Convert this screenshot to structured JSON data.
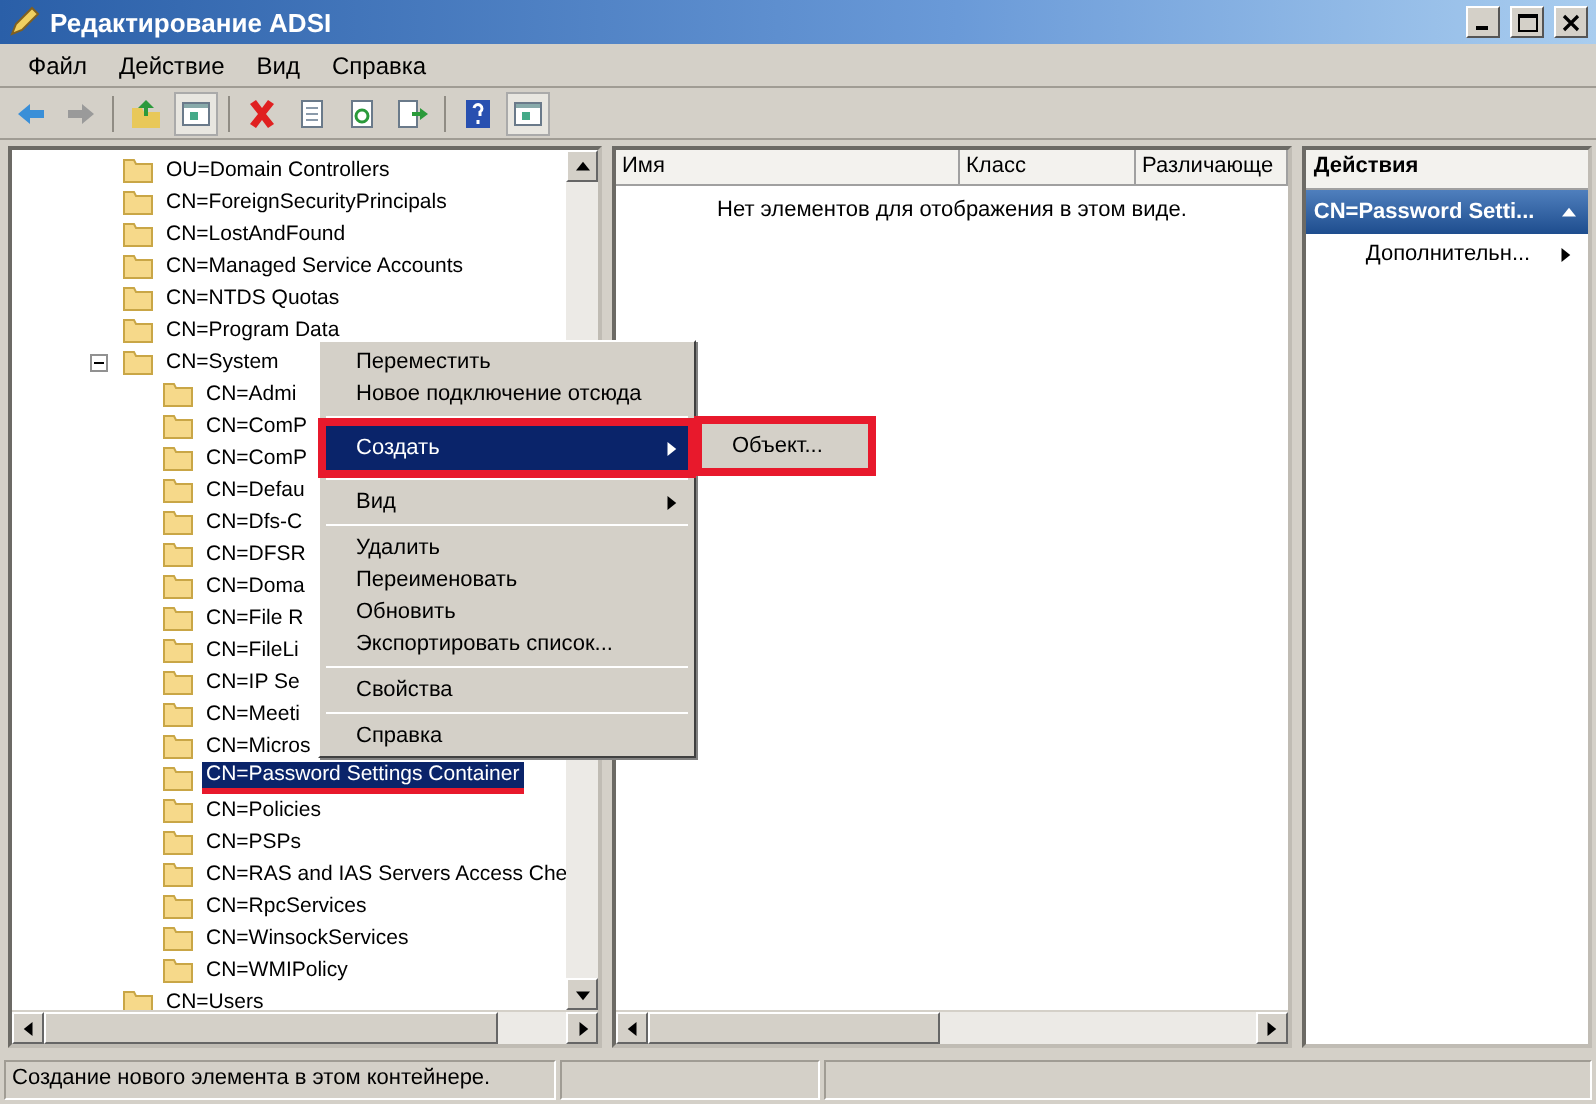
{
  "window": {
    "title": "Редактирование ADSI"
  },
  "menu_bar": [
    "Файл",
    "Действие",
    "Вид",
    "Справка"
  ],
  "tree": [
    {
      "label": "OU=Domain Controllers",
      "selected": false
    },
    {
      "label": "CN=ForeignSecurityPrincipals",
      "selected": false
    },
    {
      "label": "CN=LostAndFound",
      "selected": false
    },
    {
      "label": "CN=Managed Service Accounts",
      "selected": false
    },
    {
      "label": "CN=NTDS Quotas",
      "selected": false
    },
    {
      "label": "CN=Program Data",
      "selected": false
    },
    {
      "label": "CN=System",
      "selected": false,
      "expanded": true,
      "children": [
        {
          "label": "CN=Admi",
          "selected": false
        },
        {
          "label": "CN=ComP",
          "selected": false
        },
        {
          "label": "CN=ComP",
          "selected": false
        },
        {
          "label": "CN=Defau",
          "selected": false
        },
        {
          "label": "CN=Dfs-C",
          "selected": false
        },
        {
          "label": "CN=DFSR",
          "selected": false
        },
        {
          "label": "CN=Doma",
          "selected": false
        },
        {
          "label": "CN=File R",
          "selected": false
        },
        {
          "label": "CN=FileLi",
          "selected": false
        },
        {
          "label": "CN=IP Se",
          "selected": false
        },
        {
          "label": "CN=Meeti",
          "selected": false
        },
        {
          "label": "CN=Micros",
          "selected": false
        },
        {
          "label": "CN=Password Settings Container",
          "selected": true,
          "annotated": true
        },
        {
          "label": "CN=Policies",
          "selected": false
        },
        {
          "label": "CN=PSPs",
          "selected": false
        },
        {
          "label": "CN=RAS and IAS Servers Access Che",
          "selected": false
        },
        {
          "label": "CN=RpcServices",
          "selected": false
        },
        {
          "label": "CN=WinsockServices",
          "selected": false
        },
        {
          "label": "CN=WMIPolicy",
          "selected": false
        }
      ]
    },
    {
      "label": "CN=Users",
      "selected": false
    }
  ],
  "list_view": {
    "columns": [
      "Имя",
      "Класс",
      "Различающе"
    ],
    "empty_message": "Нет элементов для отображения в этом виде."
  },
  "actions_pane": {
    "title": "Действия",
    "section": "CN=Password Setti...",
    "items": [
      "Дополнительн..."
    ]
  },
  "context_menu": [
    {
      "kind": "item",
      "label": "Переместить",
      "selected": false
    },
    {
      "kind": "item",
      "label": "Новое подключение отсюда",
      "selected": false
    },
    {
      "kind": "separator"
    },
    {
      "kind": "submenu",
      "label": "Создать",
      "selected": true,
      "annotated": true
    },
    {
      "kind": "separator"
    },
    {
      "kind": "submenu",
      "label": "Вид",
      "selected": false
    },
    {
      "kind": "separator"
    },
    {
      "kind": "item",
      "label": "Удалить",
      "selected": false
    },
    {
      "kind": "item",
      "label": "Переименовать",
      "selected": false
    },
    {
      "kind": "item",
      "label": "Обновить",
      "selected": false
    },
    {
      "kind": "item",
      "label": "Экспортировать список...",
      "selected": false
    },
    {
      "kind": "separator"
    },
    {
      "kind": "item",
      "label": "Свойства",
      "selected": false
    },
    {
      "kind": "separator"
    },
    {
      "kind": "item",
      "label": "Справка",
      "selected": false
    }
  ],
  "submenu": [
    {
      "label": "Объект...",
      "selected": false,
      "annotated": true
    }
  ],
  "status_bar": "Создание нового элемента в этом контейнере."
}
